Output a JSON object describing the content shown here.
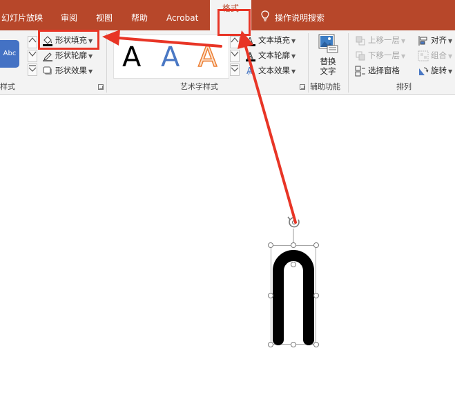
{
  "tabs": [
    {
      "label": "幻灯片放映"
    },
    {
      "label": "审阅"
    },
    {
      "label": "视图"
    },
    {
      "label": "帮助"
    },
    {
      "label": "Acrobat"
    },
    {
      "label": "格式",
      "active": true
    }
  ],
  "search": {
    "label": "操作说明搜索",
    "icon": "lightbulb-icon"
  },
  "shape_styles_group": {
    "label": "样式",
    "preset_label": "Abc",
    "commands": [
      {
        "label": "形状填充",
        "icon": "paint-bucket-icon"
      },
      {
        "label": "形状轮廓",
        "icon": "pen-outline-icon"
      },
      {
        "label": "形状效果",
        "icon": "shape-effects-icon"
      }
    ]
  },
  "wordart_group": {
    "label": "艺术字样式",
    "gallery": [
      {
        "glyph": "A",
        "style": "black-fill"
      },
      {
        "glyph": "A",
        "style": "blue-gradient"
      },
      {
        "glyph": "A",
        "style": "orange-outline"
      }
    ],
    "commands": [
      {
        "label": "文本填充",
        "icon": "text-fill-icon"
      },
      {
        "label": "文本轮廓",
        "icon": "text-outline-icon"
      },
      {
        "label": "文本效果",
        "icon": "text-effects-icon"
      }
    ]
  },
  "accessibility_group": {
    "label": "辅助功能",
    "button_line1": "替换",
    "button_line2": "文字"
  },
  "arrange_group": {
    "label": "排列",
    "commands": [
      {
        "label": "上移一层",
        "disabled": true
      },
      {
        "label": "下移一层",
        "disabled": true
      },
      {
        "label": "选择窗格",
        "disabled": false
      },
      {
        "label": "对齐",
        "disabled": false
      },
      {
        "label": "组合",
        "disabled": true
      },
      {
        "label": "旋转",
        "disabled": false
      }
    ]
  },
  "colors": {
    "accent": "#b7472a",
    "annotation": "#e83526",
    "ribbon_bg": "#f3f3f3"
  }
}
